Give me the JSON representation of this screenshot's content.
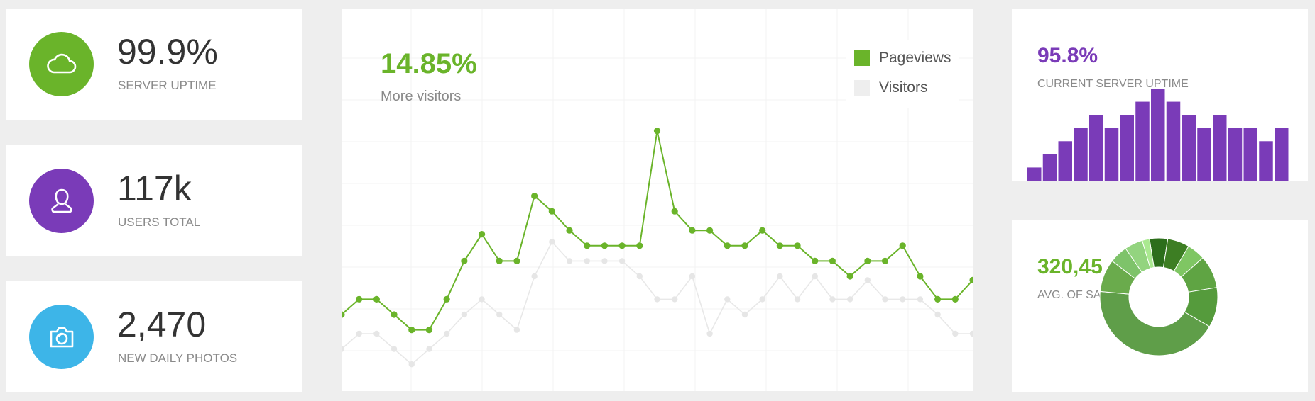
{
  "stats": [
    {
      "value": "99.9%",
      "label": "SERVER UPTIME",
      "icon": "cloud-icon",
      "color": "#6ab42a"
    },
    {
      "value": "117k",
      "label": "USERS TOTAL",
      "icon": "user-icon",
      "color": "#7a3bb8"
    },
    {
      "value": "2,470",
      "label": "NEW DAILY PHOTOS",
      "icon": "camera-icon",
      "color": "#3db5e8"
    }
  ],
  "visitors_panel": {
    "percent": "14.85%",
    "subtitle": "More visitors",
    "legend": [
      {
        "name": "Pageviews",
        "color": "#6ab42a"
      },
      {
        "name": "Visitors",
        "color": "#eeeeee"
      }
    ]
  },
  "uptime_panel": {
    "value": "95.8%",
    "label": "CURRENT SERVER UPTIME",
    "color": "#7a3bb8"
  },
  "sales_panel": {
    "value": "320,45",
    "label": "AVG. OF SALES",
    "color": "#6ab42a"
  },
  "chart_data": [
    {
      "type": "line",
      "ylim": [
        0,
        100
      ],
      "grid": true,
      "legend": "top-right",
      "series": [
        {
          "name": "Pageviews",
          "color": "#6ab42a",
          "values": [
            20,
            24,
            24,
            20,
            16,
            16,
            24,
            34,
            41,
            34,
            34,
            51,
            47,
            42,
            38,
            38,
            38,
            38,
            68,
            47,
            42,
            42,
            38,
            38,
            42,
            38,
            38,
            34,
            34,
            30,
            34,
            34,
            38,
            30,
            24,
            24,
            29
          ]
        },
        {
          "name": "Visitors",
          "color": "#eeeeee",
          "values": [
            11,
            15,
            15,
            11,
            7,
            11,
            15,
            20,
            24,
            20,
            16,
            30,
            39,
            34,
            34,
            34,
            34,
            30,
            24,
            24,
            30,
            15,
            24,
            20,
            24,
            30,
            24,
            30,
            24,
            24,
            29,
            24,
            24,
            24,
            20,
            15,
            15
          ]
        }
      ]
    },
    {
      "type": "bar",
      "values": [
        10,
        20,
        30,
        40,
        50,
        40,
        50,
        60,
        70,
        60,
        50,
        40,
        50,
        40,
        40,
        30,
        40
      ]
    },
    {
      "type": "pie",
      "values": [
        5,
        6,
        5,
        9,
        11,
        43,
        9,
        5,
        5,
        2
      ]
    }
  ]
}
